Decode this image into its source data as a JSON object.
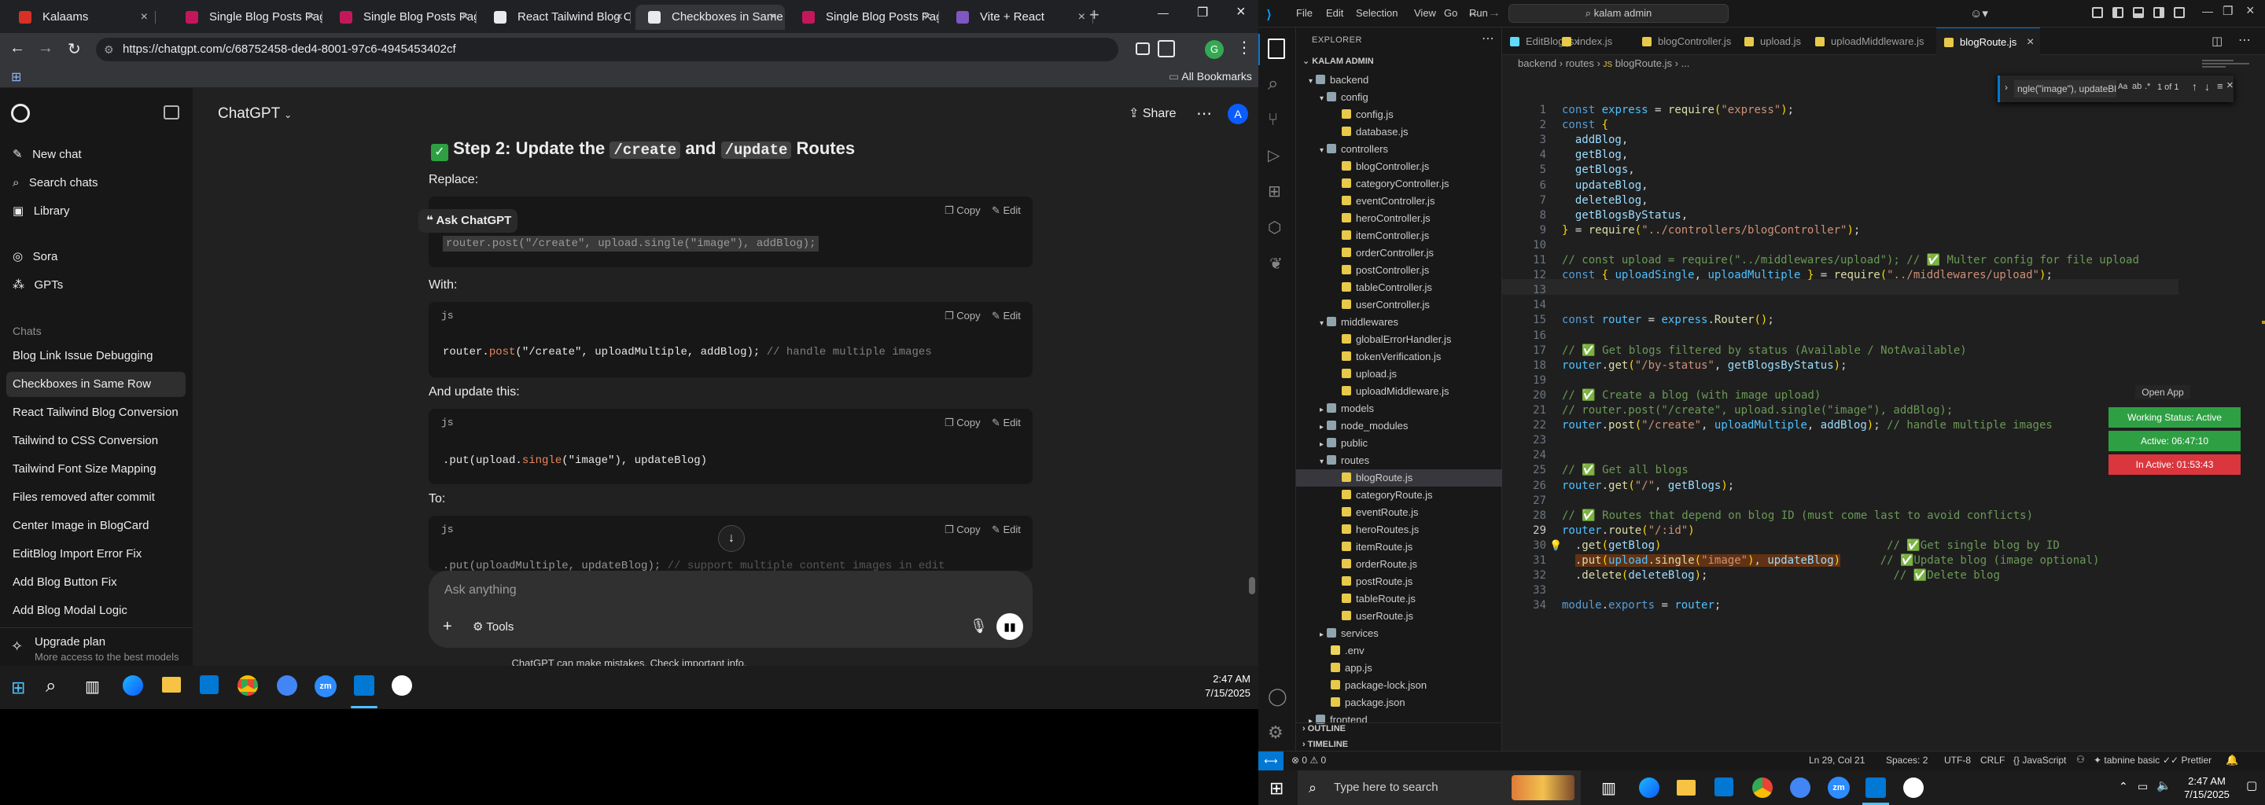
{
  "chrome": {
    "tabs": [
      {
        "label": "Kalaams",
        "fav_color": "#d93025",
        "active": false
      },
      {
        "label": "Single Blog Posts Page",
        "fav_color": "#c2185b",
        "active": false
      },
      {
        "label": "Single Blog Posts Page",
        "fav_color": "#c2185b",
        "active": false
      },
      {
        "label": "React Tailwind Blog Co",
        "fav_color": "#e8eaed",
        "active": false
      },
      {
        "label": "Checkboxes in Same R",
        "fav_color": "#e8eaed",
        "active": true
      },
      {
        "label": "Single Blog Posts Page",
        "fav_color": "#c2185b",
        "active": false
      },
      {
        "label": "Vite + React",
        "fav_color": "#7e57c2",
        "active": false
      }
    ],
    "url": "https://chatgpt.com/c/68752458-ded4-8001-97c6-4945453402cf",
    "all_bookmarks": "All Bookmarks",
    "profile_letter": "G"
  },
  "chatgpt": {
    "new_chat": "New chat",
    "search_chats": "Search chats",
    "library": "Library",
    "sora": "Sora",
    "gpts": "GPTs",
    "chats_heading": "Chats",
    "chats": [
      "Blog Link Issue Debugging",
      "Checkboxes in Same Row",
      "React Tailwind Blog Conversion",
      "Tailwind to CSS Conversion",
      "Tailwind Font Size Mapping",
      "Files removed after commit",
      "Center Image in BlogCard",
      "EditBlog Import Error Fix",
      "Add Blog Button Fix",
      "Add Blog Modal Logic"
    ],
    "upgrade_title": "Upgrade plan",
    "upgrade_sub": "More access to the best models",
    "model": "ChatGPT",
    "share": "Share",
    "avatar_letter": "A",
    "step_heading": "Step 2: Update the",
    "step_code1": "/create",
    "step_and": "and",
    "step_code2": "/update",
    "step_routes": "Routes",
    "replace": "Replace:",
    "ask_chatgpt": "Ask ChatGPT",
    "with": "With:",
    "and_update": "And update this:",
    "to": "To:",
    "copy": "Copy",
    "edit": "Edit",
    "lang": "js",
    "code1": "router.post(\"/create\", upload.single(\"image\"), addBlog);",
    "code2_a": "router.",
    "code2_b": "post",
    "code2_c": "(\"/create\", uploadMultiple, addBlog); ",
    "code2_d": "// handle multiple images",
    "code3_a": ".put(upload.",
    "code3_b": "single",
    "code3_c": "(\"image\"), updateBlog)",
    "code4_a": ".put(uploadMultiple, updateBlog); ",
    "code4_b": "// support multiple content images in edit",
    "input_placeholder": "Ask anything",
    "tools": "Tools",
    "disclaimer": "ChatGPT can make mistakes. Check important info."
  },
  "taskbar_left": {
    "time": "2:47 AM",
    "date": "7/15/2025"
  },
  "vscode": {
    "menu": [
      "File",
      "Edit",
      "Selection",
      "View",
      "Go",
      "Run"
    ],
    "search_title": "kalam admin",
    "explorer_title": "EXPLORER",
    "root": "KALAM ADMIN",
    "tree": [
      {
        "label": "backend",
        "depth": 0,
        "kind": "folder-open"
      },
      {
        "label": "config",
        "depth": 1,
        "kind": "folder-open"
      },
      {
        "label": "config.js",
        "depth": 2,
        "kind": "js"
      },
      {
        "label": "database.js",
        "depth": 2,
        "kind": "js"
      },
      {
        "label": "controllers",
        "depth": 1,
        "kind": "folder-open"
      },
      {
        "label": "blogController.js",
        "depth": 2,
        "kind": "js"
      },
      {
        "label": "categoryController.js",
        "depth": 2,
        "kind": "js"
      },
      {
        "label": "eventController.js",
        "depth": 2,
        "kind": "js"
      },
      {
        "label": "heroController.js",
        "depth": 2,
        "kind": "js"
      },
      {
        "label": "itemController.js",
        "depth": 2,
        "kind": "js"
      },
      {
        "label": "orderController.js",
        "depth": 2,
        "kind": "js"
      },
      {
        "label": "postController.js",
        "depth": 2,
        "kind": "js"
      },
      {
        "label": "tableController.js",
        "depth": 2,
        "kind": "js"
      },
      {
        "label": "userController.js",
        "depth": 2,
        "kind": "js"
      },
      {
        "label": "middlewares",
        "depth": 1,
        "kind": "folder-open"
      },
      {
        "label": "globalErrorHandler.js",
        "depth": 2,
        "kind": "js"
      },
      {
        "label": "tokenVerification.js",
        "depth": 2,
        "kind": "js"
      },
      {
        "label": "upload.js",
        "depth": 2,
        "kind": "js"
      },
      {
        "label": "uploadMiddleware.js",
        "depth": 2,
        "kind": "js"
      },
      {
        "label": "models",
        "depth": 1,
        "kind": "folder"
      },
      {
        "label": "node_modules",
        "depth": 1,
        "kind": "folder"
      },
      {
        "label": "public",
        "depth": 1,
        "kind": "folder"
      },
      {
        "label": "routes",
        "depth": 1,
        "kind": "folder-open"
      },
      {
        "label": "blogRoute.js",
        "depth": 2,
        "kind": "js",
        "selected": true
      },
      {
        "label": "categoryRoute.js",
        "depth": 2,
        "kind": "js"
      },
      {
        "label": "eventRoute.js",
        "depth": 2,
        "kind": "js"
      },
      {
        "label": "heroRoutes.js",
        "depth": 2,
        "kind": "js"
      },
      {
        "label": "itemRoute.js",
        "depth": 2,
        "kind": "js"
      },
      {
        "label": "orderRoute.js",
        "depth": 2,
        "kind": "js"
      },
      {
        "label": "postRoute.js",
        "depth": 2,
        "kind": "js"
      },
      {
        "label": "tableRoute.js",
        "depth": 2,
        "kind": "js"
      },
      {
        "label": "userRoute.js",
        "depth": 2,
        "kind": "js"
      },
      {
        "label": "services",
        "depth": 1,
        "kind": "folder"
      },
      {
        "label": ".env",
        "depth": 1,
        "kind": "env"
      },
      {
        "label": "app.js",
        "depth": 1,
        "kind": "js"
      },
      {
        "label": "package-lock.json",
        "depth": 1,
        "kind": "json"
      },
      {
        "label": "package.json",
        "depth": 1,
        "kind": "json"
      },
      {
        "label": "frontend",
        "depth": 0,
        "kind": "folder"
      }
    ],
    "outline": "OUTLINE",
    "timeline": "TIMELINE",
    "tabs": [
      "EditBlog.jsx",
      "index.js",
      "blogController.js",
      "upload.js",
      "uploadMiddleware.js",
      "blogRoute.js"
    ],
    "breadcrumb": [
      "backend",
      "routes",
      "blogRoute.js",
      "..."
    ],
    "find_text": "ngle(\"image\"), updateBlog)",
    "find_count": "1 of 1",
    "open_app": "Open App",
    "working_status": "Working Status: Active",
    "active_time": "Active: 06:47:10",
    "inactive_time": "In Active: 01:53:43",
    "status": {
      "errors": "0",
      "warnings": "0",
      "position": "Ln 29, Col 21",
      "spaces": "Spaces: 2",
      "encoding": "UTF-8",
      "eol": "CRLF",
      "language": "JavaScript",
      "tabnine": "tabnine basic",
      "prettier": "Prettier"
    }
  },
  "taskbar_right": {
    "search": "Type here to search",
    "time": "2:47 AM",
    "date": "7/15/2025"
  }
}
